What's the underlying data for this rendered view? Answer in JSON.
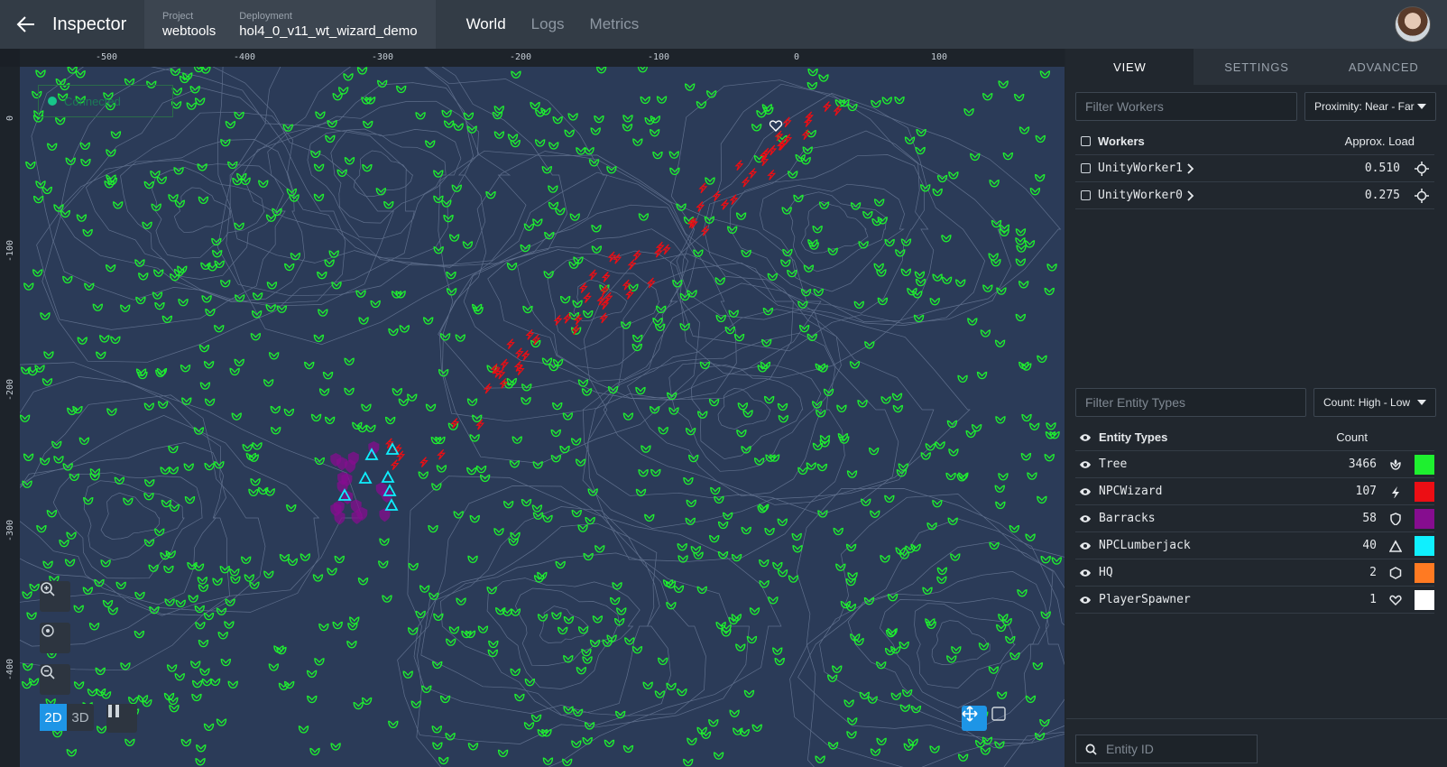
{
  "topbar": {
    "back_icon": "arrow-left-icon",
    "title": "Inspector",
    "project_label": "Project",
    "project_value": "webtools",
    "deployment_label": "Deployment",
    "deployment_value": "hol4_0_v11_wt_wizard_demo",
    "nav": [
      "World",
      "Logs",
      "Metrics"
    ],
    "active_nav": "World"
  },
  "map": {
    "x_ticks": [
      "-500",
      "-400",
      "-300",
      "-200",
      "-100",
      "0",
      "100"
    ],
    "y_ticks": [
      "0",
      "-100",
      "-200",
      "-300",
      "-400"
    ],
    "connection_status": "Connected",
    "view_2d": "2D",
    "view_3d": "3D"
  },
  "panel": {
    "tabs": [
      "VIEW",
      "SETTINGS",
      "ADVANCED"
    ],
    "active_tab": "VIEW",
    "workers_filter_placeholder": "Filter Workers",
    "workers_sort": "Proximity: Near - Far",
    "workers_header": "Workers",
    "load_header": "Approx. Load",
    "workers": [
      {
        "name": "UnityWorker1",
        "load": "0.510"
      },
      {
        "name": "UnityWorker0",
        "load": "0.275"
      }
    ],
    "entity_filter_placeholder": "Filter Entity Types",
    "entity_sort": "Count: High - Low",
    "entity_header": "Entity Types",
    "count_header": "Count",
    "entities": [
      {
        "name": "Tree",
        "count": "3466",
        "icon": "tree-icon",
        "color": "#1ef02f"
      },
      {
        "name": "NPCWizard",
        "count": "107",
        "icon": "lightning-icon",
        "color": "#ec0e14"
      },
      {
        "name": "Barracks",
        "count": "58",
        "icon": "shield-icon",
        "color": "#860d8f"
      },
      {
        "name": "NPCLumberjack",
        "count": "40",
        "icon": "triangle-icon",
        "color": "#0ff0ff"
      },
      {
        "name": "HQ",
        "count": "2",
        "icon": "hexagon-icon",
        "color": "#ff7a22"
      },
      {
        "name": "PlayerSpawner",
        "count": "1",
        "icon": "heart-icon",
        "color": "#ffffff"
      }
    ],
    "entity_id_placeholder": "Entity ID"
  }
}
